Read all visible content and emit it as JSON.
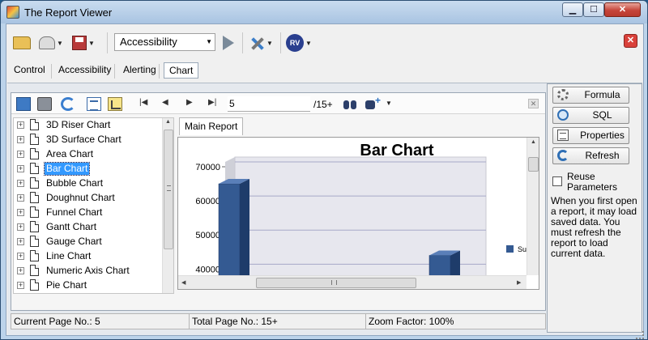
{
  "window": {
    "title": "The Report Viewer"
  },
  "toolbar": {
    "combo_value": "Accessibility"
  },
  "tabs": [
    {
      "label": "Control"
    },
    {
      "label": "Accessibility"
    },
    {
      "label": "Alerting"
    },
    {
      "label": "Chart",
      "active": true
    }
  ],
  "navigation": {
    "page_input": "5",
    "page_total": "/15+"
  },
  "tree": {
    "items": [
      {
        "label": "3D Riser Chart",
        "selected": false
      },
      {
        "label": "3D Surface Chart",
        "selected": false
      },
      {
        "label": "Area Chart",
        "selected": false
      },
      {
        "label": "Bar Chart",
        "selected": true
      },
      {
        "label": "Bubble Chart",
        "selected": false
      },
      {
        "label": "Doughnut Chart",
        "selected": false
      },
      {
        "label": "Funnel Chart",
        "selected": false
      },
      {
        "label": "Gantt Chart",
        "selected": false
      },
      {
        "label": "Gauge Chart",
        "selected": false
      },
      {
        "label": "Line Chart",
        "selected": false
      },
      {
        "label": "Numeric Axis Chart",
        "selected": false
      },
      {
        "label": "Pie Chart",
        "selected": false
      }
    ]
  },
  "report": {
    "tab_label": "Main Report"
  },
  "chart_data": {
    "type": "bar",
    "title": "Bar Chart",
    "y_ticks": [
      70000,
      60000,
      50000,
      40000
    ],
    "ylim": [
      37000,
      70000
    ],
    "categories": [
      "",
      ""
    ],
    "values": [
      65000,
      44000
    ],
    "legend_text": "Su Ye",
    "legend_position": "right",
    "grid": true,
    "colors": {
      "bar_front": "#345a92",
      "bar_side": "#1e3c6a",
      "bar_top": "#5a7fb8"
    }
  },
  "status": {
    "current_page": "Current Page No.: 5",
    "total_pages": "Total Page No.: 15+",
    "zoom": "Zoom Factor: 100%"
  },
  "sidepanel": {
    "formula_label": "Formula",
    "sql_label": "SQL",
    "properties_label": "Properties",
    "refresh_label": "Refresh",
    "reuse_label": "Reuse Parameters",
    "help_text": "When you first open a report, it may load saved data.  You must refresh the report to load current data."
  }
}
